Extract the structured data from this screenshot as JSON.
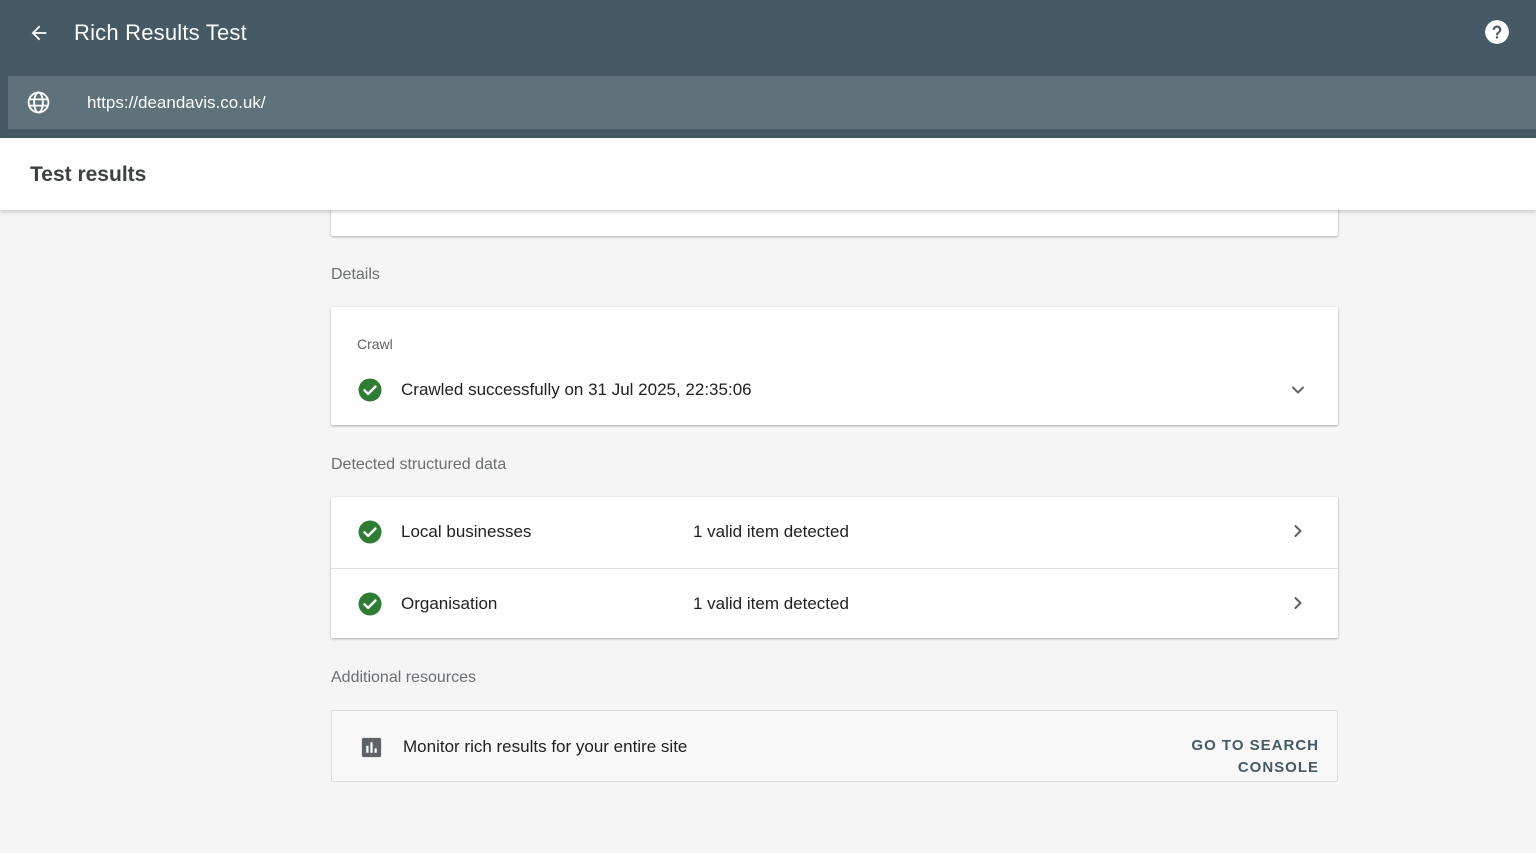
{
  "header": {
    "title": "Rich Results Test",
    "back_icon": "arrow-back-icon",
    "help_icon": "help-icon",
    "color": "#455a64"
  },
  "url_bar": {
    "value": "https://deandavis.co.uk/",
    "icon": "globe-icon"
  },
  "results_bar": {
    "title": "Test results"
  },
  "details": {
    "section_label": "Details",
    "crawl": {
      "label": "Crawl",
      "status": "Crawled successfully on 31 Jul 2025, 22:35:06",
      "status_icon": "check-circle-icon",
      "expand_icon": "chevron-down-icon"
    }
  },
  "structured_data": {
    "section_label": "Detected structured data",
    "items": [
      {
        "name": "Local businesses",
        "result": "1 valid item detected"
      },
      {
        "name": "Organisation",
        "result": "1 valid item detected"
      }
    ],
    "success_color": "#2e7d32"
  },
  "additional_resources": {
    "section_label": "Additional resources",
    "text": "Monitor rich results for your entire site",
    "button_label": "GO TO SEARCH CONSOLE",
    "icon": "bar-chart-icon"
  }
}
